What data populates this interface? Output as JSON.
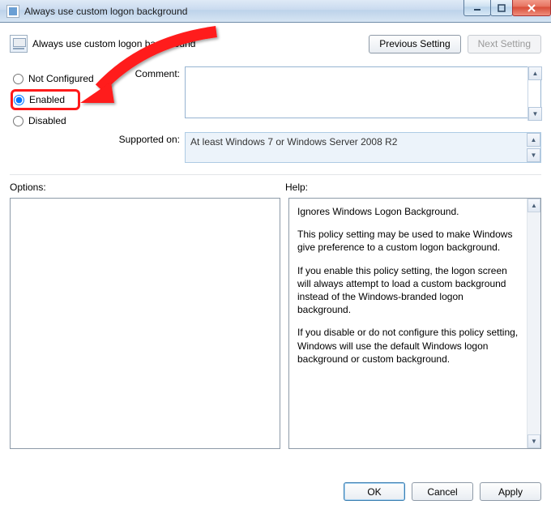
{
  "window": {
    "title": "Always use custom logon background"
  },
  "header": {
    "policy_name": "Always use custom logon background",
    "prev_btn": "Previous Setting",
    "next_btn": "Next Setting"
  },
  "state": {
    "not_configured": "Not Configured",
    "enabled": "Enabled",
    "disabled": "Disabled",
    "selected": "enabled"
  },
  "fields": {
    "comment_label": "Comment:",
    "comment_value": "",
    "supported_label": "Supported on:",
    "supported_value": "At least Windows 7 or Windows Server 2008 R2"
  },
  "lower": {
    "options_label": "Options:",
    "help_label": "Help:"
  },
  "help": {
    "p1": "Ignores Windows Logon Background.",
    "p2": "This policy setting may be used to make Windows give preference to a custom logon background.",
    "p3": "If you enable this policy setting, the logon screen will always attempt to load a custom background instead of the Windows-branded logon background.",
    "p4": "If you disable or do not configure this policy setting, Windows will use the default Windows logon background or custom background."
  },
  "buttons": {
    "ok": "OK",
    "cancel": "Cancel",
    "apply": "Apply"
  }
}
